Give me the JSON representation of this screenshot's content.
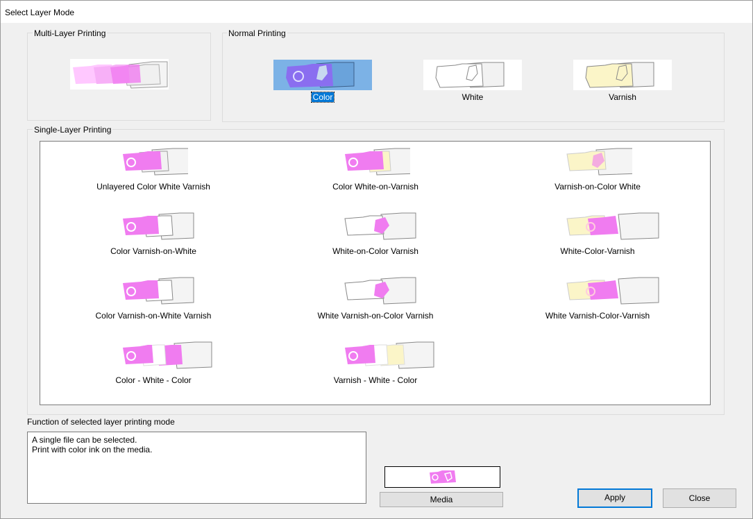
{
  "dialog": {
    "title": "Select Layer Mode"
  },
  "multi_layer": {
    "label": "Multi-Layer Printing"
  },
  "normal": {
    "label": "Normal Printing",
    "modes": [
      {
        "label": "Color",
        "selected": true
      },
      {
        "label": "White",
        "selected": false
      },
      {
        "label": "Varnish",
        "selected": false
      }
    ]
  },
  "single_layer": {
    "label": "Single-Layer Printing",
    "modes": [
      "Unlayered Color White Varnish",
      "Color White-on-Varnish",
      "Varnish-on-Color White",
      "Color Varnish-on-White",
      "White-on-Color Varnish",
      "White-Color-Varnish",
      "Color Varnish-on-White Varnish",
      "White Varnish-on-Color Varnish",
      "White Varnish-Color-Varnish",
      "Color - White - Color",
      "Varnish - White - Color"
    ]
  },
  "function": {
    "label": "Function of selected layer printing mode",
    "lines": [
      "A single file can be selected.",
      "Print with color ink on the media."
    ]
  },
  "buttons": {
    "media": "Media",
    "apply": "Apply",
    "close": "Close"
  },
  "colors": {
    "color_ink": "#f07cf0",
    "varnish": "#fbf5c8",
    "white": "#ffffff",
    "selected_bg": "#7cb2e6",
    "selected_label": "#0078d7"
  }
}
